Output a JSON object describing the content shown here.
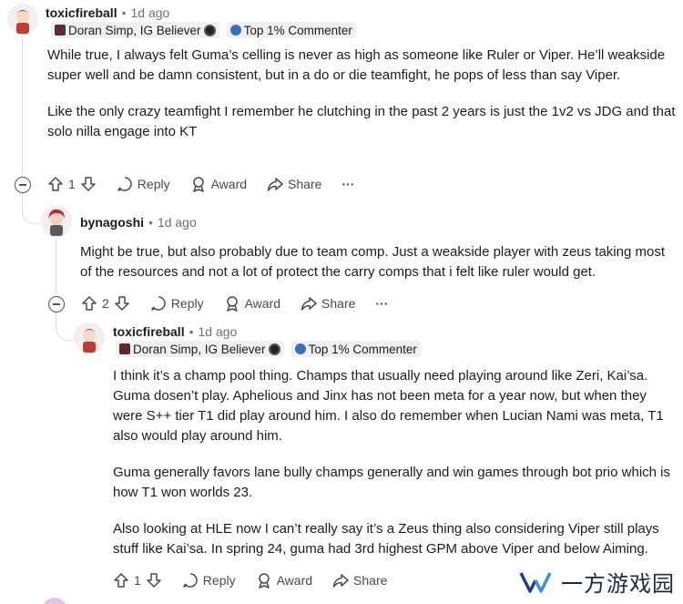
{
  "comments": [
    {
      "username": "toxicfireball",
      "time": "1d ago",
      "flair": "Doran Simp, IG Believer",
      "badge": "Top 1% Commenter",
      "paragraphs": [
        "While true, I always felt Guma’s celling is never as high as someone like Ruler or Viper. He’ll weakside super well and be damn consistent, but in a do or die teamfight, he pops of less than say Viper.",
        "Like the only crazy teamfight I remember he clutching in the past 2 years is just the 1v2 vs JDG and that solo nilla engage into KT"
      ],
      "votes": "1"
    },
    {
      "username": "bynagoshi",
      "time": "1d ago",
      "paragraphs": [
        "Might be true, but also probably due to team comp. Just a weakside player with zeus taking most of the resources and not a lot of protect the carry comps that i felt like ruler would get."
      ],
      "votes": "2"
    },
    {
      "username": "toxicfireball",
      "time": "1d ago",
      "flair": "Doran Simp, IG Believer",
      "badge": "Top 1% Commenter",
      "paragraphs": [
        "I think it’s a champ pool thing. Champs that usually need playing around like Zeri, Kai’sa. Guma dosen’t play. Aphelious and Jinx has not been meta for a year now, but when they were S++ tier T1 did play around him. I also do remember when Lucian Nami was meta, T1 also would play around him.",
        "Guma generally favors lane bully champs generally and win games through bot prio which is how T1 won worlds 23.",
        "Also looking at HLE now I can’t really say it’s a Zeus thing also considering Viper still plays stuff like Kai’sa. In spring 24, guma had 3rd highest GPM above Viper and below Aiming."
      ],
      "votes": "1"
    }
  ],
  "actions": {
    "reply": "Reply",
    "award": "Award",
    "share": "Share",
    "more": "···"
  },
  "watermark": "一方游戏园"
}
